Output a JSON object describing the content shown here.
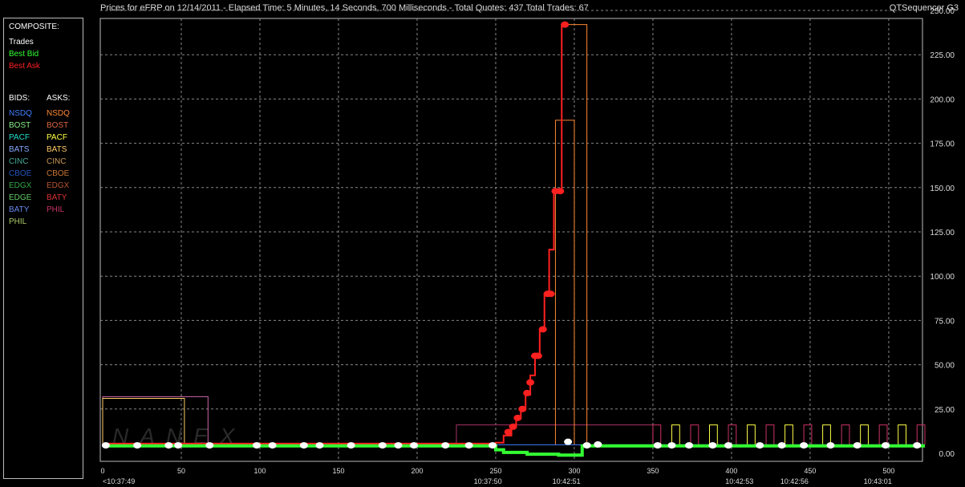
{
  "header": {
    "title": "Prices for  eFRP  on  12/14/2011  -  Elapsed Time: 5 Minutes, 14 Seconds, 700 Milliseconds  -  Total Quotes: 437  Total Trades: 67",
    "app_name": "QTSequencer G3"
  },
  "legend": {
    "composite_label": "COMPOSITE:",
    "composite_items": [
      {
        "label": "Trades",
        "color": "#ffffff"
      },
      {
        "label": "Best Bid",
        "color": "#33ff33"
      },
      {
        "label": "Best Ask",
        "color": "#ff2020"
      }
    ],
    "bids_label": "BIDS:",
    "asks_label": "ASKS:",
    "bids": [
      {
        "label": "NSDQ",
        "color": "#3f7fff"
      },
      {
        "label": "BOST",
        "color": "#88ee88"
      },
      {
        "label": "PACF",
        "color": "#22ddcc"
      },
      {
        "label": "BATS",
        "color": "#88aaff"
      },
      {
        "label": "CINC",
        "color": "#44aa99"
      },
      {
        "label": "CBOE",
        "color": "#2255bb"
      },
      {
        "label": "EDGX",
        "color": "#33aa44"
      },
      {
        "label": "EDGE",
        "color": "#66cc66"
      },
      {
        "label": "BATY",
        "color": "#6688ee"
      },
      {
        "label": "PHIL",
        "color": "#aacc66"
      }
    ],
    "asks": [
      {
        "label": "NSDQ",
        "color": "#ff8833"
      },
      {
        "label": "BOST",
        "color": "#dd6644"
      },
      {
        "label": "PACF",
        "color": "#ffff44"
      },
      {
        "label": "BATS",
        "color": "#ffcc66"
      },
      {
        "label": "CINC",
        "color": "#cc9955"
      },
      {
        "label": "CBOE",
        "color": "#cc7733"
      },
      {
        "label": "EDGX",
        "color": "#bb5533"
      },
      {
        "label": "BATY",
        "color": "#dd3333"
      },
      {
        "label": "PHIL",
        "color": "#cc3366"
      }
    ]
  },
  "watermark": "NANEX",
  "chart_data": {
    "type": "line",
    "xlim": [
      0,
      523
    ],
    "ylim": [
      0,
      250
    ],
    "grid": true,
    "x_ticks": [
      0,
      50,
      100,
      150,
      200,
      250,
      300,
      350,
      400,
      450,
      500
    ],
    "x_tick_labels": [
      "0",
      "50",
      "100",
      "150",
      "200",
      "250",
      "300",
      "350",
      "400",
      "450",
      "500"
    ],
    "y_ticks": [
      0,
      25,
      50,
      75,
      100,
      125,
      150,
      175,
      200,
      225,
      250
    ],
    "y_tick_labels": [
      "0.00",
      "25.00",
      "50.00",
      "75.00",
      "100.00",
      "125.00",
      "150.00",
      "175.00",
      "200.00",
      "225.00",
      "250.00"
    ],
    "time_labels": [
      {
        "x": 0,
        "label": "<10:37:49"
      },
      {
        "x": 245,
        "label": "10:37:50"
      },
      {
        "x": 295,
        "label": "10:42:51"
      },
      {
        "x": 405,
        "label": "10:42:53"
      },
      {
        "x": 440,
        "label": "10:42:56"
      },
      {
        "x": 493,
        "label": "10:43:01"
      }
    ],
    "series": [
      {
        "name": "Best Ask",
        "color": "#ff2020",
        "points": [
          [
            0,
            5.5
          ],
          [
            245,
            5.5
          ],
          [
            250,
            6
          ],
          [
            255,
            10
          ],
          [
            260,
            15
          ],
          [
            263,
            20
          ],
          [
            266,
            25
          ],
          [
            269,
            33
          ],
          [
            272,
            44
          ],
          [
            275,
            55
          ],
          [
            278,
            70
          ],
          [
            281,
            90
          ],
          [
            284,
            115
          ],
          [
            287,
            148
          ],
          [
            292,
            242
          ],
          [
            295,
            242
          ]
        ]
      },
      {
        "name": "Best Bid",
        "color": "#33ff33",
        "points": [
          [
            0,
            4.2
          ],
          [
            245,
            4.2
          ],
          [
            250,
            2
          ],
          [
            255,
            0.5
          ],
          [
            270,
            -0.5
          ],
          [
            290,
            -1
          ],
          [
            300,
            -1
          ],
          [
            305,
            4.2
          ],
          [
            523,
            4.2
          ]
        ]
      },
      {
        "name": "Trades",
        "color": "#ffffff",
        "points": [
          [
            2,
            4.5
          ],
          [
            22,
            4.5
          ],
          [
            42,
            4.5
          ],
          [
            48,
            4.5
          ],
          [
            68,
            4.5
          ],
          [
            98,
            4.5
          ],
          [
            108,
            4.5
          ],
          [
            128,
            4.5
          ],
          [
            138,
            4.5
          ],
          [
            158,
            4.5
          ],
          [
            178,
            4.5
          ],
          [
            188,
            4.5
          ],
          [
            198,
            4.5
          ],
          [
            218,
            4.5
          ],
          [
            233,
            4.5
          ],
          [
            248,
            4.5
          ],
          [
            296,
            6.5
          ],
          [
            308,
            4.5
          ],
          [
            315,
            5
          ],
          [
            353,
            4.5
          ],
          [
            362,
            4.5
          ],
          [
            373,
            4.5
          ],
          [
            388,
            4.5
          ],
          [
            398,
            4.5
          ],
          [
            418,
            4.5
          ],
          [
            432,
            4.5
          ],
          [
            446,
            4.5
          ],
          [
            463,
            4.5
          ],
          [
            480,
            4.5
          ],
          [
            498,
            4.5
          ],
          [
            518,
            4.5
          ]
        ]
      },
      {
        "name": "Trades (red)",
        "color": "#ff2020",
        "points": [
          [
            258,
            12
          ],
          [
            261,
            15
          ],
          [
            264,
            20
          ],
          [
            267,
            25
          ],
          [
            270,
            34
          ],
          [
            272,
            40
          ],
          [
            275,
            55
          ],
          [
            277,
            55
          ],
          [
            280,
            70
          ],
          [
            283,
            90
          ],
          [
            285,
            90
          ],
          [
            288,
            148
          ],
          [
            291,
            148
          ],
          [
            294,
            242
          ]
        ]
      }
    ]
  }
}
